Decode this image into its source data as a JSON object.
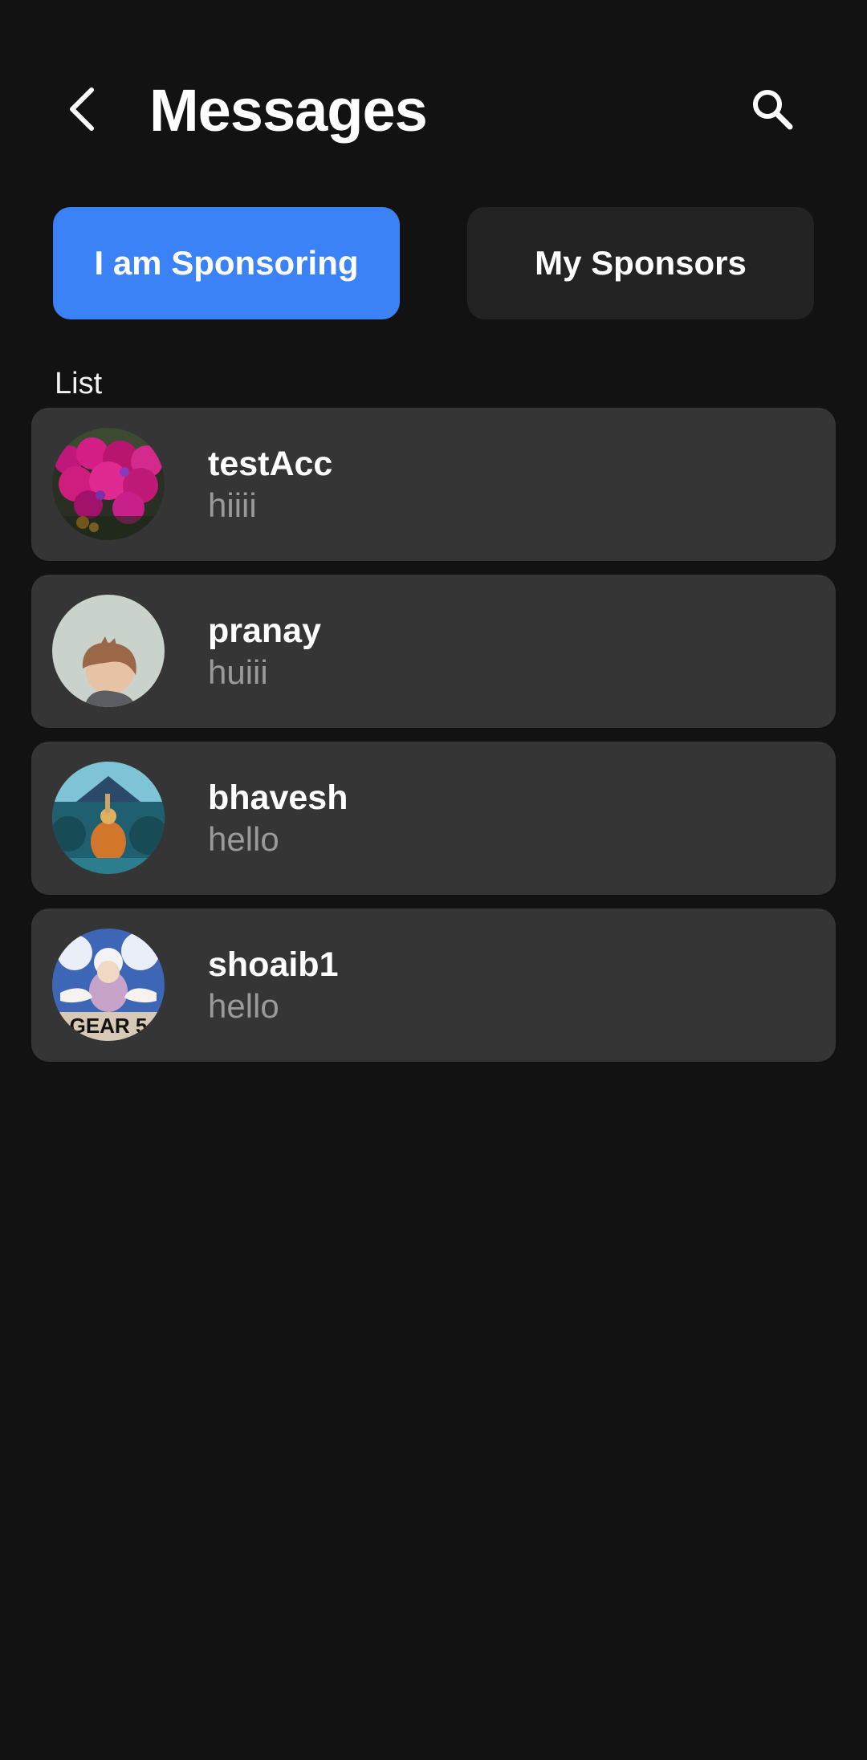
{
  "colors": {
    "background": "#121212",
    "accent": "#3B82F6",
    "tab_inactive": "#232323",
    "card": "#353535",
    "text_primary": "#FFFFFF",
    "text_secondary": "#9A9A9A"
  },
  "header": {
    "back_icon": "chevron-left-icon",
    "title": "Messages",
    "search_icon": "search-icon"
  },
  "tabs": [
    {
      "label": "I am Sponsoring",
      "active": true
    },
    {
      "label": "My Sponsors",
      "active": false
    }
  ],
  "list": {
    "label": "List",
    "items": [
      {
        "name": "testAcc",
        "preview": "hiiii",
        "avatar": "flowers-photo"
      },
      {
        "name": "pranay",
        "preview": "huiii",
        "avatar": "anime-character-portrait"
      },
      {
        "name": "bhavesh",
        "preview": "hello",
        "avatar": "anime-mountain-scene"
      },
      {
        "name": "shoaib1",
        "preview": "hello",
        "avatar": "gear5-anime-art",
        "avatar_caption": "GEAR 5"
      }
    ]
  }
}
